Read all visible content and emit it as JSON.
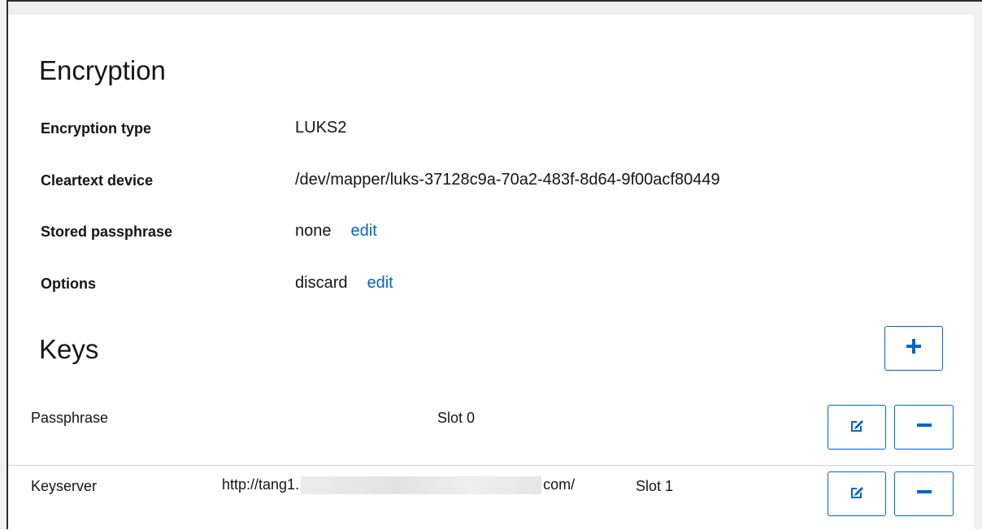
{
  "encryption": {
    "title": "Encryption",
    "rows": [
      {
        "label": "Encryption type",
        "value": "LUKS2",
        "link": ""
      },
      {
        "label": "Cleartext device",
        "value": "/dev/mapper/luks-37128c9a-70a2-483f-8d64-9f00acf80449",
        "link": ""
      },
      {
        "label": "Stored passphrase",
        "value": "none",
        "link": "edit"
      },
      {
        "label": "Options",
        "value": "discard",
        "link": "edit"
      }
    ]
  },
  "keys": {
    "title": "Keys",
    "add_icon": "plus-icon",
    "items": [
      {
        "type": "Passphrase",
        "detail_prefix": "",
        "detail_suffix": "",
        "slot": "Slot 0",
        "edit_icon": "edit-icon",
        "remove_icon": "minus-icon"
      },
      {
        "type": "Keyserver",
        "detail_prefix": "http://tang1.",
        "detail_suffix": "com/",
        "slot": "Slot 1",
        "edit_icon": "edit-icon",
        "remove_icon": "minus-icon"
      }
    ]
  },
  "colors": {
    "accent": "#0066cc",
    "text": "#151515",
    "divider": "#d2d2d2"
  }
}
